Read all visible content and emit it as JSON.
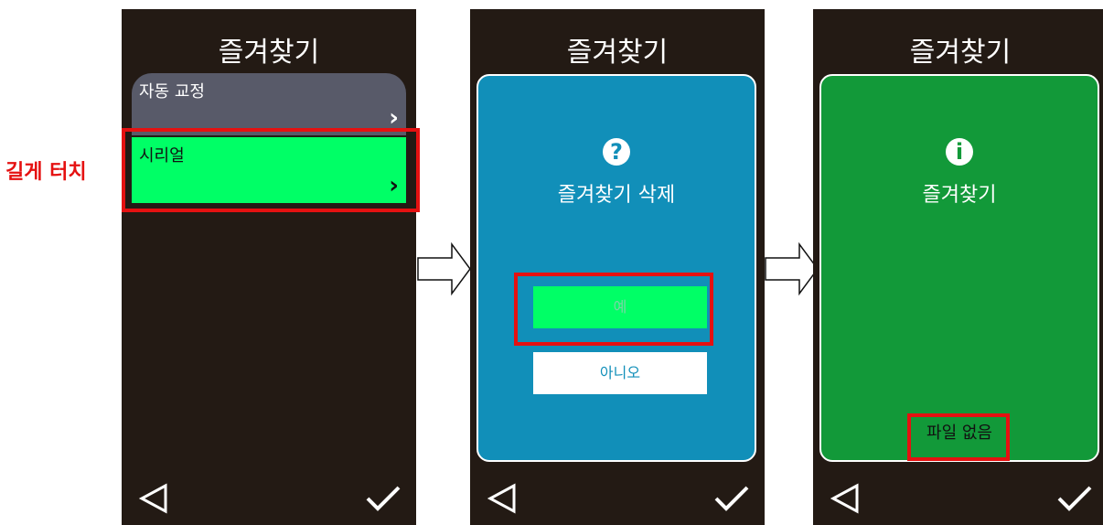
{
  "annotation": {
    "long_touch_label": "길게 터치"
  },
  "screen1": {
    "title": "즐겨찾기",
    "items": [
      {
        "label": "자동 교정",
        "chevron": "›"
      },
      {
        "label": "시리얼",
        "chevron": "›"
      }
    ]
  },
  "screen2": {
    "title": "즐겨찾기",
    "icon": "?",
    "message": "즐겨찾기 삭제",
    "yes_label": "예",
    "no_label": "아니오"
  },
  "screen3": {
    "title": "즐겨찾기",
    "icon": "i",
    "message": "즐겨찾기",
    "status": "파일 없음"
  },
  "colors": {
    "screen_bg": "#231a14",
    "item_gray": "#585a69",
    "item_selected": "#00ff66",
    "dialog_blue": "#118fb9",
    "info_green": "#129939",
    "highlight_red": "#e51111"
  },
  "icons": [
    "back-triangle-icon",
    "check-icon",
    "question-icon",
    "info-icon",
    "chevron-right-icon",
    "right-arrow-icon"
  ]
}
